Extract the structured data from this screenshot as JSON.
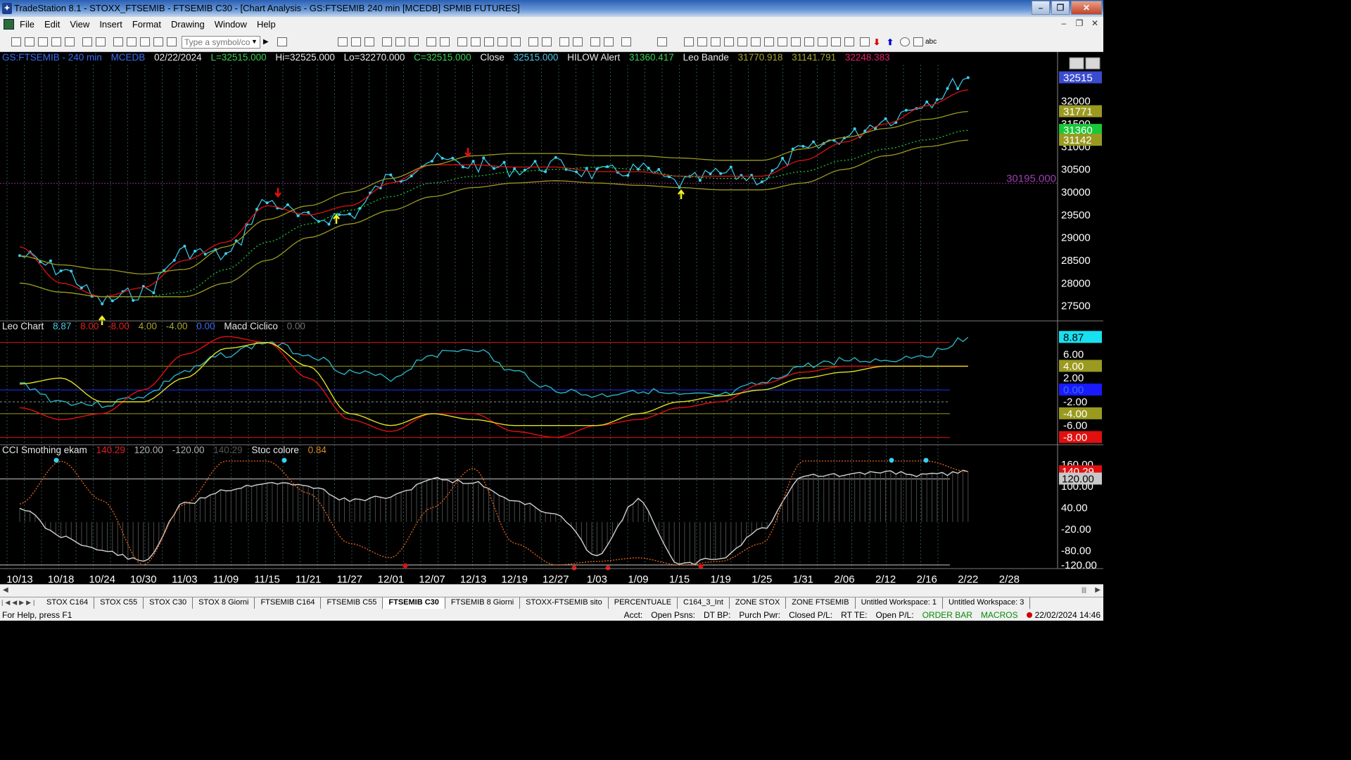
{
  "window": {
    "title": "TradeStation 8.1 - STOXX_FTSEMIB - FTSEMIB C30 - [Chart Analysis - GS:FTSEMIB  240 min  [MCEDB] SPMIB FUTURES]"
  },
  "menu": [
    "File",
    "Edit",
    "View",
    "Insert",
    "Format",
    "Drawing",
    "Window",
    "Help"
  ],
  "toolbar": {
    "symbol_placeholder": "Type a symbol/co"
  },
  "header1": {
    "symbol": "GS:FTSEMIB - 240 min",
    "source": "MCEDB",
    "date": "02/22/2024",
    "last": "L=32515.000",
    "hi": "Hi=32525.000",
    "lo": "Lo=32270.000",
    "close_c": "C=32515.000",
    "close_label": "Close",
    "close_val": "32515.000",
    "hilow_label": "HILOW Alert",
    "hilow_val": "31360.417",
    "leo_label": "Leo Bande",
    "leo1": "31770.918",
    "leo2": "31141.791",
    "leo3": "32248.383"
  },
  "header2": {
    "name": "Leo Chart",
    "v1": "8.87",
    "v2": "8.00",
    "v3": "-8.00",
    "v4": "4.00",
    "v5": "-4.00",
    "v6": "0.00",
    "macd_label": "Macd Ciclico",
    "macd_val": "0.00"
  },
  "header3": {
    "name": "CCI Smothing ekam",
    "v1": "140.29",
    "v2": "120.00",
    "v3": "-120.00",
    "v4": "140.29",
    "stoc_label": "Stoc colore",
    "stoc_val": "0.84"
  },
  "price_axis": {
    "ticks": [
      "32000",
      "31500",
      "31000",
      "30500",
      "30000",
      "29500",
      "29000",
      "28500",
      "28000",
      "27500"
    ],
    "tick_values": [
      32000,
      31500,
      31000,
      30500,
      30000,
      29500,
      29000,
      28500,
      28000,
      27500
    ],
    "badges": [
      {
        "text": "32515",
        "value": 32515,
        "bg": "#3b4bd0",
        "fg": "#ffffff"
      },
      {
        "text": "31771",
        "value": 31771,
        "bg": "#9a9a20",
        "fg": "#ffffff"
      },
      {
        "text": "31360",
        "value": 31360,
        "bg": "#18c838",
        "fg": "#ffffff"
      },
      {
        "text": "31142",
        "value": 31142,
        "bg": "#9a9a20",
        "fg": "#ffffff"
      }
    ],
    "hline_label": "30195.000",
    "hline_value": 30195
  },
  "macd_axis": {
    "ticks": [
      "6.00",
      "2.00",
      "-2.00",
      "-6.00"
    ],
    "tick_values": [
      6,
      2,
      -2,
      -6
    ],
    "badges": [
      {
        "text": "8.87",
        "value": 8.87,
        "bg": "#18e0f0",
        "fg": "#000000"
      },
      {
        "text": "4.00",
        "value": 4,
        "bg": "#9a9a20",
        "fg": "#ffffff"
      },
      {
        "text": "0.00",
        "value": 0,
        "bg": "#1a1aff",
        "fg": "#3b6df2"
      },
      {
        "text": "-4.00",
        "value": -4,
        "bg": "#9a9a20",
        "fg": "#ffffff"
      },
      {
        "text": "-8.00",
        "value": -8,
        "bg": "#e01010",
        "fg": "#ffffff"
      }
    ]
  },
  "cci_axis": {
    "ticks": [
      "160.00",
      "100.00",
      "40.00",
      "-20.00",
      "-80.00",
      "-120.00"
    ],
    "tick_values": [
      160,
      100,
      40,
      -20,
      -80,
      -120
    ],
    "badges": [
      {
        "text": "140.29",
        "value": 140.29,
        "bg": "#e01010",
        "fg": "#ffffff"
      },
      {
        "text": "120.00",
        "value": 120,
        "bg": "#c8c8c8",
        "fg": "#000000"
      }
    ]
  },
  "date_axis": [
    "10/13",
    "10/18",
    "10/24",
    "10/30",
    "11/03",
    "11/09",
    "11/15",
    "11/21",
    "11/27",
    "12/01",
    "12/07",
    "12/13",
    "12/19",
    "12/27",
    "1/03",
    "1/09",
    "1/15",
    "1/19",
    "1/25",
    "1/31",
    "2/06",
    "2/12",
    "2/16",
    "2/22",
    "2/28"
  ],
  "tabs": [
    "STOX C164",
    "STOX C55",
    "STOX  C30",
    "STOX  8 Giorni",
    "FTSEMIB C164",
    "FTSEMIB C55",
    "FTSEMIB C30",
    "FTSEMIB  8 Giorni",
    "STOXX-FTSEMIB sito",
    "PERCENTUALE",
    "C164_3_Int",
    "ZONE STOX",
    "ZONE FTSEMIB",
    "Untitled Workspace:  1",
    "Untitled Workspace:  3"
  ],
  "active_tab": 6,
  "status": {
    "help": "For Help, press F1",
    "acct": "Acct:",
    "open_psns": "Open Psns:",
    "dt_bp": "DT BP:",
    "purch_pwr": "Purch Pwr:",
    "closed_pl": "Closed P/L:",
    "rt_te": "RT TE:",
    "open_pl": "Open P/L:",
    "order_bar": "ORDER BAR",
    "macros": "MACROS",
    "datetime": "22/02/2024 14:46"
  },
  "chart_data": {
    "type": "line",
    "title": "",
    "x": [
      "10/13",
      "10/18",
      "10/24",
      "10/30",
      "11/03",
      "11/09",
      "11/15",
      "11/21",
      "11/27",
      "12/01",
      "12/07",
      "12/13",
      "12/19",
      "12/27",
      "1/03",
      "1/09",
      "1/15",
      "1/19",
      "1/25",
      "1/31",
      "2/06",
      "2/12",
      "2/16",
      "2/22"
    ],
    "series": [
      {
        "color": "#3ad0f0",
        "values": [
          28600,
          28300,
          27600,
          27800,
          28700,
          28600,
          29800,
          29400,
          29500,
          30300,
          30700,
          30600,
          30500,
          30600,
          30400,
          30500,
          30200,
          30400,
          30300,
          30900,
          31200,
          31600,
          32000,
          32515
        ]
      },
      {
        "color": "#e01010",
        "values": [
          28800,
          28000,
          27700,
          27900,
          28500,
          28900,
          29700,
          29500,
          29700,
          30200,
          30600,
          30600,
          30550,
          30550,
          30450,
          30450,
          30350,
          30350,
          30350,
          30700,
          31100,
          31500,
          31900,
          32248
        ]
      },
      {
        "color": "#9a9a20",
        "values": [
          28600,
          28400,
          28300,
          28200,
          28300,
          28800,
          29400,
          29700,
          30000,
          30300,
          30600,
          30800,
          30850,
          30850,
          30800,
          30800,
          30750,
          30700,
          30700,
          30950,
          31200,
          31400,
          31600,
          31771
        ]
      },
      {
        "color": "#18c838",
        "values": [
          28000,
          27800,
          27700,
          27700,
          27800,
          28300,
          28900,
          29300,
          29600,
          29900,
          30200,
          30350,
          30450,
          30500,
          30550,
          30500,
          30350,
          30300,
          30300,
          30450,
          30700,
          30950,
          31150,
          31360
        ]
      },
      {
        "color": "#9a9a20",
        "values": [
          28000,
          27800,
          27700,
          27700,
          27700,
          28000,
          28500,
          29000,
          29300,
          29600,
          29900,
          30100,
          30200,
          30250,
          30200,
          30150,
          30100,
          30050,
          30050,
          30200,
          30500,
          30800,
          31000,
          31142
        ]
      }
    ],
    "macd_panel": {
      "ylim": [
        -9,
        9.5
      ],
      "series": [
        {
          "color": "#2ab0c0",
          "values": [
            1,
            -2,
            -2.5,
            -1,
            3,
            6,
            8,
            6,
            3,
            2,
            6,
            7,
            3,
            0,
            -1,
            0,
            -1,
            -1,
            1,
            4,
            5,
            5,
            6,
            8.87
          ]
        },
        {
          "color": "#e01010",
          "values": [
            -3,
            -5,
            -4,
            0,
            6,
            9,
            8,
            2,
            -5,
            -7,
            -4,
            -4,
            -7,
            -8,
            -6,
            -5,
            -3,
            -2,
            1,
            3,
            4,
            4,
            4,
            4
          ]
        },
        {
          "color": "#e0e020",
          "values": [
            1,
            2,
            -2,
            -2,
            2,
            7,
            8,
            4,
            -4,
            -6,
            -4,
            -5,
            -6,
            -6,
            -6,
            -4,
            -2,
            -1,
            0,
            2,
            3,
            4,
            4,
            4
          ]
        }
      ]
    },
    "cci_panel": {
      "ylim": [
        -130,
        180
      ],
      "series": [
        {
          "color": "#c8c8c8",
          "values": [
            40,
            -40,
            -80,
            -110,
            50,
            90,
            110,
            100,
            60,
            70,
            120,
            110,
            60,
            20,
            -90,
            60,
            -120,
            -100,
            -20,
            130,
            130,
            140,
            130,
            140.29
          ]
        },
        {
          "color": "#e8661a",
          "values": [
            50,
            170,
            60,
            -120,
            50,
            170,
            170,
            80,
            -60,
            -100,
            40,
            150,
            -60,
            -120,
            -110,
            -100,
            -120,
            -110,
            -60,
            170,
            170,
            170,
            170,
            140
          ]
        }
      ]
    }
  }
}
